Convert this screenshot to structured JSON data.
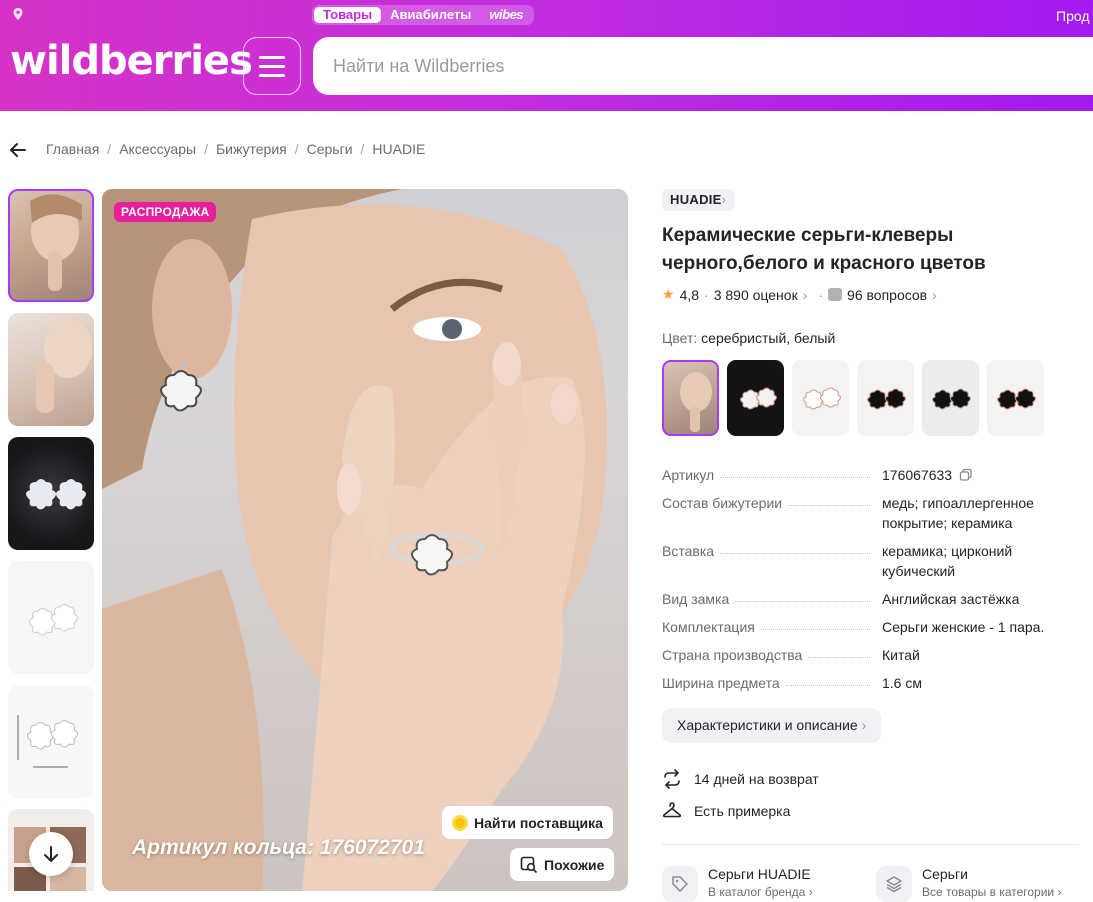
{
  "header": {
    "tabs": [
      {
        "label": "Товары",
        "active": true
      },
      {
        "label": "Авиабилеты",
        "active": false
      },
      {
        "label": "wibes",
        "active": false
      }
    ],
    "sell_link": "Прод",
    "logo": "wildberries",
    "search_placeholder": "Найти на Wildberries"
  },
  "breadcrumb": [
    "Главная",
    "Аксессуары",
    "Бижутерия",
    "Серьги",
    "HUADIE"
  ],
  "gallery": {
    "badge": "РАСПРОДАЖА",
    "caption": "Артикул кольца: 176072701",
    "find_supplier": "Найти поставщика",
    "similar": "Похожие"
  },
  "product": {
    "brand": "HUADIE",
    "title": "Керамические серьги-клеверы черного,белого и красного цветов",
    "rating": "4,8",
    "reviews": "3 890 оценок",
    "questions": "96 вопросов",
    "color_label": "Цвет:",
    "color_value": "серебристый, белый",
    "specs": [
      {
        "key": "Артикул",
        "value": "176067633"
      },
      {
        "key": "Состав бижутерии",
        "value": "медь; гипоаллергенное покрытие; керамика"
      },
      {
        "key": "Вставка",
        "value": "керамика; цирконий кубический"
      },
      {
        "key": "Вид замка",
        "value": "Английская застёжка"
      },
      {
        "key": "Комплектация",
        "value": "Серьги женские - 1 пара."
      },
      {
        "key": "Страна производства",
        "value": "Китай"
      },
      {
        "key": "Ширина предмета",
        "value": "1.6 см"
      }
    ],
    "desc_button": "Характеристики и описание",
    "perks": [
      "14 дней на возврат",
      "Есть примерка"
    ],
    "links": [
      {
        "title": "Серьги HUADIE",
        "sub": "В каталог бренда"
      },
      {
        "title": "Серьги",
        "sub": "Все товары в категории"
      }
    ]
  },
  "colors": {
    "accent": "#a73afd",
    "sale": "#e61f9b",
    "rating_star": "#ff9d3a"
  }
}
